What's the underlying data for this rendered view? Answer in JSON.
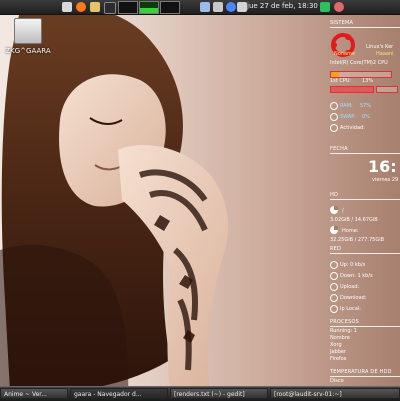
{
  "top_panel": {
    "clock": "jue 27 de feb, 18:30",
    "icons": [
      "menu-icon",
      "browser-icon",
      "folder-icon",
      "terminal-icon",
      "network-icon",
      "volume-icon",
      "bluetooth-icon",
      "update-icon",
      "calendar-icon"
    ]
  },
  "desktop": {
    "icon_label": "ZKG^GAARA"
  },
  "conky": {
    "sistema_title": "SISTEMA",
    "os_name": "Linux's Ker",
    "hostname_1": "Noname",
    "hostname_2": "Haaani",
    "cpu_model": "Intel(R) Core(TM)2 CPU",
    "cpu_1_label": "1st CPU:",
    "cpu_1_value": "13%",
    "cpu_1_fraction": 0.13,
    "ram_label": "RAM:",
    "ram_value": "57%",
    "ram_fraction": 0.57,
    "swap_label": "SWAP:",
    "swap_value": "0%",
    "swap_fraction": 0.0,
    "activity_label": "Actividad:",
    "fecha_title": "FECHA",
    "time": "16:",
    "date": "viernes 29",
    "hd_title": "HD",
    "hd_root_label": "/",
    "hd_root_value": "3.02GiB / 14.67GiB",
    "hd_home_label": "Home:",
    "hd_home_value": "32.25GiB / 277.75GiB",
    "red_title": "RED",
    "up_label": "Up: 0 kb/s",
    "down_label": "Down: 1 kb/s",
    "upload_label": "Upload:",
    "download_label": "Download:",
    "ip_label": "Ip Local:",
    "procesos_title": "PROCESOS",
    "running_label": "Running: 1",
    "proc_header": "Nombre",
    "proc_1": "Xorg",
    "proc_2": "Jabber",
    "proc_3": "Firefox",
    "temp_title": "TEMPERATURA DE HDD",
    "temp_disk": "Disco"
  },
  "taskbar": {
    "items": [
      {
        "label": "Anime ~ Ver..."
      },
      {
        "label": "gaara - Navegador d..."
      },
      {
        "label": "[renders.txt (~) - gedit]"
      },
      {
        "label": "[root@laudit-srv-01:~]"
      }
    ]
  }
}
